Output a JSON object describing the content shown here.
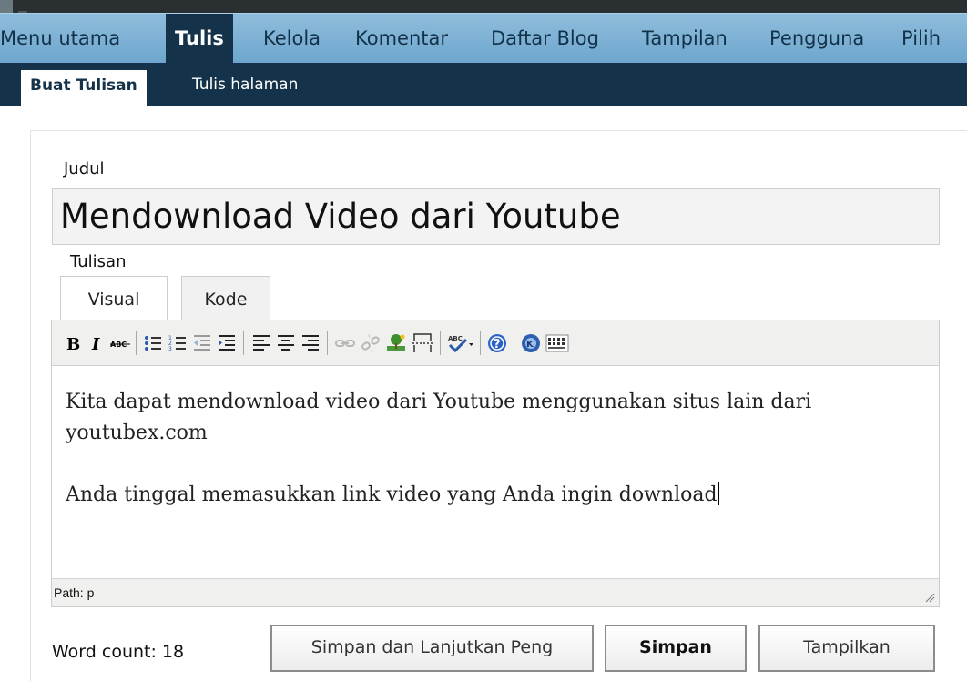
{
  "nav": {
    "main": [
      {
        "label": "Menu utama"
      },
      {
        "label": "Tulis"
      },
      {
        "label": "Kelola"
      },
      {
        "label": "Komentar"
      },
      {
        "label": "Daftar Blog"
      },
      {
        "label": "Tampilan"
      },
      {
        "label": "Pengguna"
      },
      {
        "label": "Pilih"
      }
    ],
    "active_main": "Tulis",
    "sub": [
      {
        "label": "Buat Tulisan"
      },
      {
        "label": "Tulis halaman"
      }
    ],
    "active_sub": "Buat Tulisan"
  },
  "form": {
    "title_label": "Judul",
    "title_value": "Mendownload Video dari Youtube",
    "post_label": "Tulisan",
    "tabs": [
      {
        "label": "Visual"
      },
      {
        "label": "Kode"
      }
    ],
    "active_tab": "Visual"
  },
  "toolbar": {
    "buttons": [
      {
        "icon": "bold-icon"
      },
      {
        "icon": "italic-icon"
      },
      {
        "icon": "strikethrough-icon"
      },
      {
        "icon": "bullet-list-icon"
      },
      {
        "icon": "numbered-list-icon"
      },
      {
        "icon": "outdent-icon"
      },
      {
        "icon": "indent-icon"
      },
      {
        "icon": "align-left-icon"
      },
      {
        "icon": "align-center-icon"
      },
      {
        "icon": "align-right-icon"
      },
      {
        "icon": "link-icon"
      },
      {
        "icon": "unlink-icon"
      },
      {
        "icon": "insert-image-icon"
      },
      {
        "icon": "more-break-icon"
      },
      {
        "icon": "spellcheck-icon"
      },
      {
        "icon": "help-icon"
      },
      {
        "icon": "media-icon"
      },
      {
        "icon": "kitchen-sink-icon"
      }
    ]
  },
  "editor": {
    "paragraphs": [
      "Kita dapat mendownload video dari Youtube menggunakan situs lain dari youtubex.com",
      "Anda tinggal memasukkan link video yang Anda ingin download"
    ],
    "path": "Path: p"
  },
  "footer": {
    "word_count": "Word count: 18",
    "buttons": {
      "save_continue": "Simpan dan Lanjutkan Peng",
      "save": "Simpan",
      "preview": "Tampilkan"
    }
  },
  "colors": {
    "nav_bg": "#7fb3d8",
    "nav_active_bg": "#14334a",
    "subnav_bg": "#14334a",
    "toolbar_bg": "#f0f0ee"
  }
}
